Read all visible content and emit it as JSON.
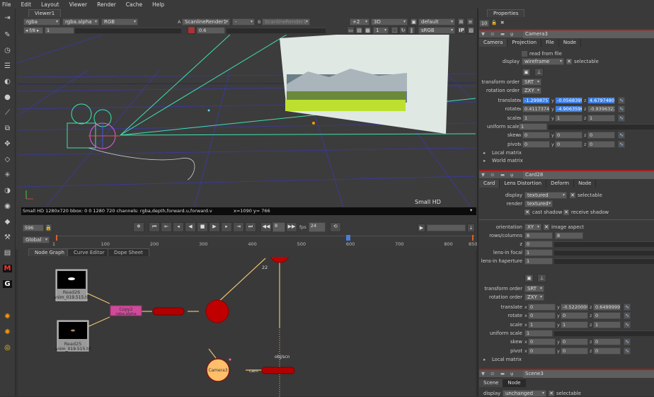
{
  "menu": [
    "File",
    "Edit",
    "Layout",
    "Viewer",
    "Render",
    "Cache",
    "Help"
  ],
  "viewer": {
    "tab": "Viewer1",
    "channels": "rgba",
    "alpha": "rgba.alpha",
    "display_channels": "RGB",
    "input_a_label": "A",
    "input_a": "ScanlineRender1",
    "input_a2": "-",
    "input_b_label": "B",
    "input_b": "ScanlineRender1",
    "downrez": "+2",
    "mode": "3D",
    "camera": "default",
    "fstop": "f/8",
    "gain": "1",
    "gamma": "0.6",
    "proxy": "1",
    "lut": "sRGB",
    "ip": "IP",
    "format_label": "Small HD",
    "info": "Small HD 1280x720 bbox: 0 0 1280 720 channels: rgba,depth,forward.u,forward.v",
    "coords": "x=1090 y= 766"
  },
  "timeline": {
    "frame": "596",
    "increment": "8",
    "fps_label": "fps",
    "fps": "24",
    "range": "Global",
    "ticks": [
      "1",
      "100",
      "200",
      "300",
      "400",
      "500",
      "600",
      "700",
      "800",
      "850"
    ],
    "current_frame": 596,
    "start": 1,
    "end": 850
  },
  "nodegraph": {
    "tabs": [
      "Node Graph",
      "Curve Editor",
      "Dope Sheet"
    ],
    "nodes": {
      "read26": "Read26",
      "read26_file": "anim_019.515.tif",
      "read25": "Read25",
      "read25_file": "anim_019.515.tif",
      "copy2": "Copy2",
      "copy2_sub": "rgba.alpha",
      "camera3": "Camera3",
      "frame_label": "22",
      "cam_label": "cam",
      "obj_label": "obj/scn"
    }
  },
  "properties": {
    "tab": "Properties",
    "max_panels": "10",
    "camera": {
      "name": "Camera3",
      "tabs": [
        "Camera",
        "Projection",
        "File",
        "Node"
      ],
      "read_from_file": "read from file",
      "display_label": "display",
      "display": "wireframe",
      "selectable": "selectable",
      "transform_order_label": "transform order",
      "transform_order": "SRT",
      "rotation_order_label": "rotation order",
      "rotation_order": "ZXY",
      "translate_label": "translate",
      "translate": [
        "-1.29987574",
        "-0.05683995",
        "4.67974806"
      ],
      "rotate_label": "rotate",
      "rotate": [
        "0.41173741",
        "-4.90635962",
        "-0.93963223"
      ],
      "scale_label": "scale",
      "scale": [
        "1",
        "1",
        "1"
      ],
      "uniform_scale_label": "uniform scale",
      "uniform_scale": "1",
      "skew_label": "skew",
      "skew": [
        "0",
        "0",
        "0"
      ],
      "pivot_label": "pivot",
      "pivot": [
        "0",
        "0",
        "0"
      ],
      "local_matrix": "Local matrix",
      "world_matrix": "World matrix"
    },
    "card": {
      "name": "Card28",
      "tabs": [
        "Card",
        "Lens Distortion",
        "Deform",
        "Node"
      ],
      "display_label": "display",
      "display": "textured",
      "selectable": "selectable",
      "render_label": "render",
      "render": "textured",
      "cast_shadow": "cast shadow",
      "receive_shadow": "receive shadow",
      "orientation_label": "orientation",
      "orientation": "XY",
      "image_aspect": "image aspect",
      "rows_columns_label": "rows/columns",
      "rows": "8",
      "columns": "8",
      "z_label": "z",
      "z": "0",
      "lens_focal_label": "lens-in focal",
      "lens_focal": "1",
      "lens_haperture_label": "lens-in haperture",
      "lens_haperture": "1",
      "transform_order_label": "transform order",
      "transform_order": "SRT",
      "rotation_order_label": "rotation order",
      "rotation_order": "ZXY",
      "translate_label": "translate",
      "translate": [
        "0",
        "-0.52200001",
        "0.64999998"
      ],
      "rotate_label": "rotate",
      "rotate": [
        "0",
        "0",
        "0"
      ],
      "scale_label": "scale",
      "scale": [
        "1",
        "1",
        "1"
      ],
      "uniform_scale_label": "uniform scale",
      "uniform_scale": "1",
      "skew_label": "skew",
      "skew": [
        "0",
        "0",
        "0"
      ],
      "pivot_label": "pivot",
      "pivot": [
        "0",
        "0",
        "0"
      ],
      "local_matrix": "Local matrix"
    },
    "scene": {
      "name": "Scene3",
      "tabs": [
        "Scene",
        "Node"
      ],
      "display_label": "display",
      "display": "unchanged",
      "selectable": "selectable"
    }
  },
  "colors": {
    "accent_selection": "#3d7ee0",
    "node_header_border": "#a02020",
    "viewer_bg": "#3c3c3c",
    "grid": "#3a3aa8",
    "camera_frustum": "#40e0b0"
  }
}
